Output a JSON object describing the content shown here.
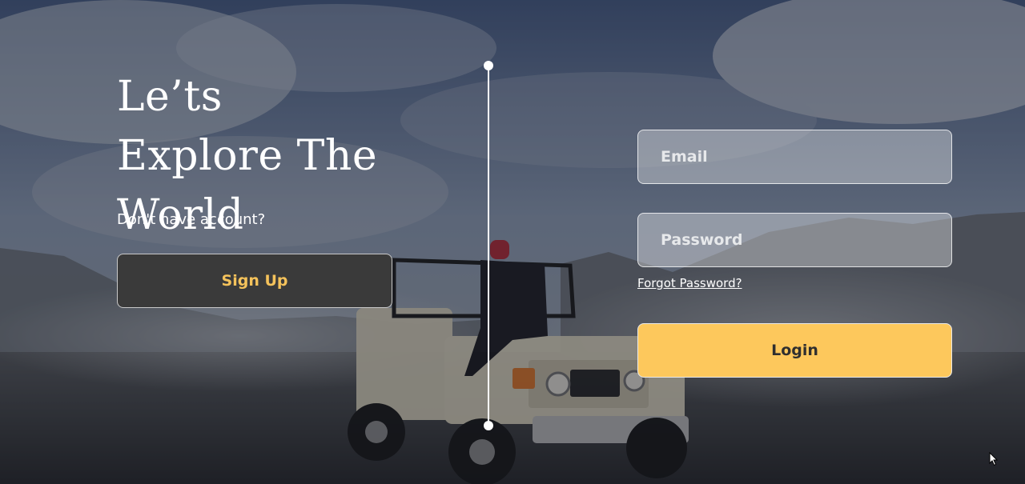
{
  "hero": {
    "headline_lines": [
      "Le’ts",
      "Explore The",
      "World"
    ],
    "no_account_text": "Don't have account?",
    "signup_label": "Sign Up"
  },
  "login_form": {
    "email_placeholder": "Email",
    "password_placeholder": "Password",
    "forgot_password_label": "Forgot Password?",
    "login_label": "Login"
  },
  "colors": {
    "accent_yellow": "#fdc85c",
    "signup_text": "#f4c25b",
    "signup_bg": "#3a3a3a",
    "divider": "#ffffff"
  },
  "icons": {
    "cursor": "mouse-pointer-icon"
  }
}
